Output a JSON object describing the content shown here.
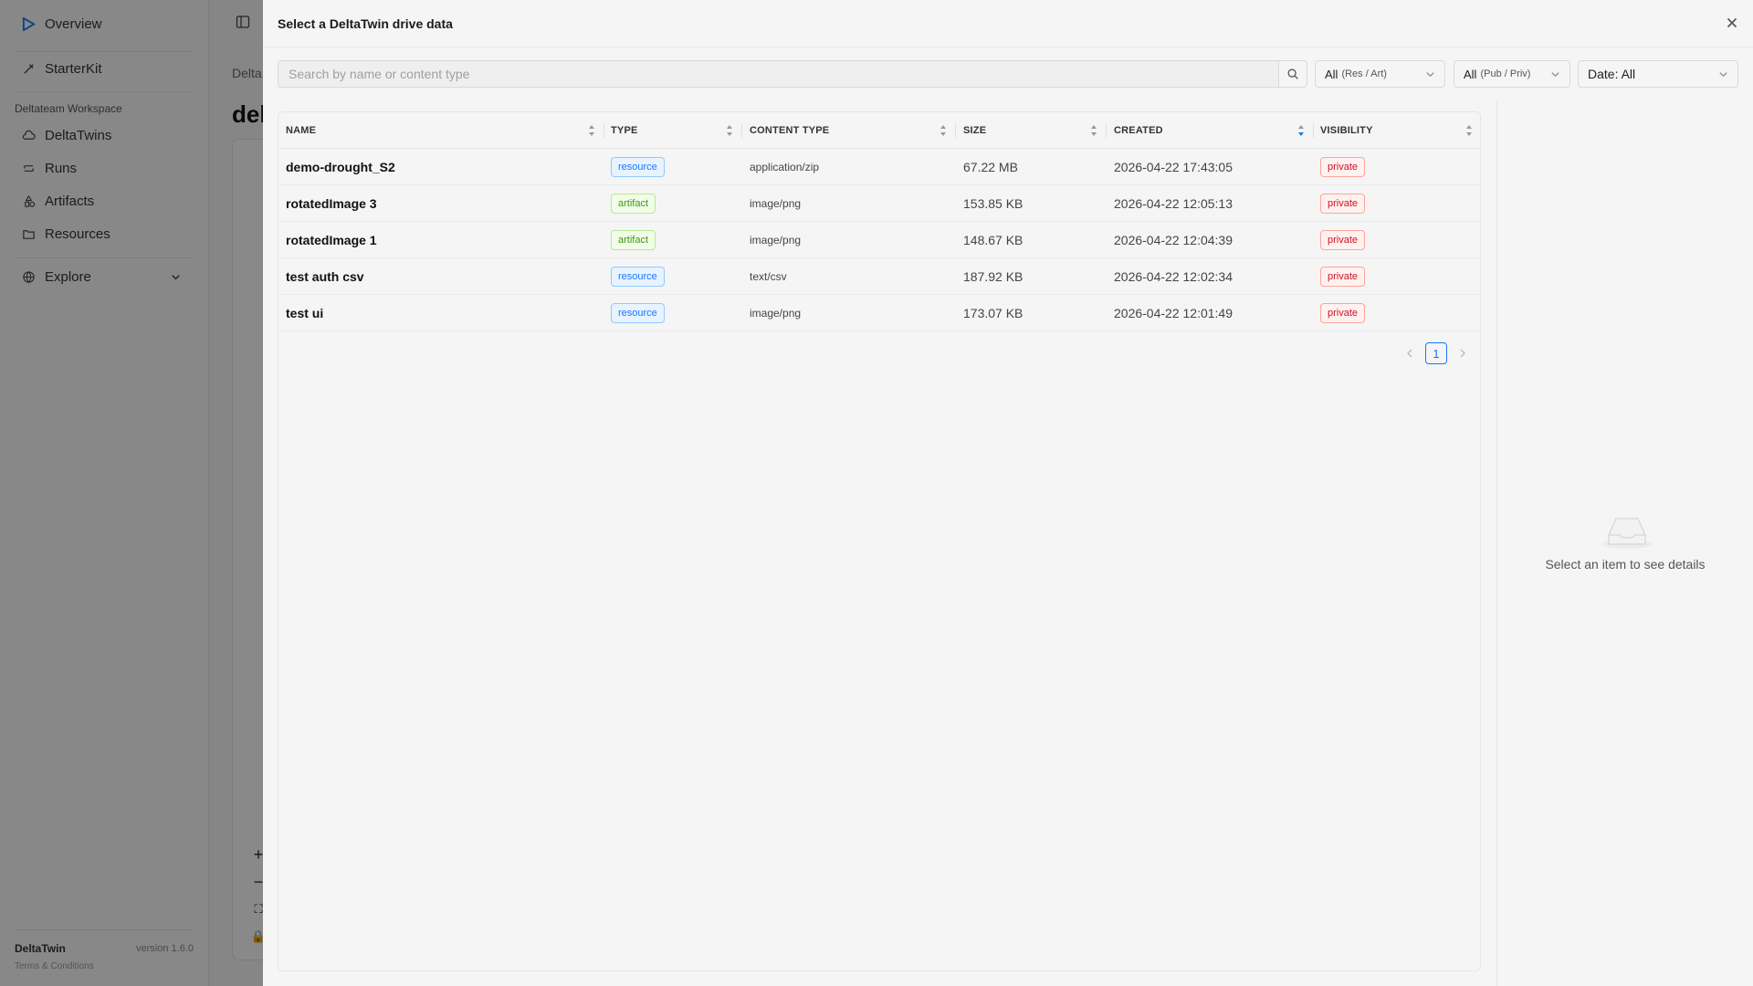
{
  "app": {
    "brand": "Overview",
    "starterkit": "StarterKit",
    "workspace_label": "Deltateam Workspace",
    "nav": [
      {
        "label": "DeltaTwins",
        "icon": "cloud-icon"
      },
      {
        "label": "Runs",
        "icon": "runs-icon"
      },
      {
        "label": "Artifacts",
        "icon": "artifacts-icon"
      },
      {
        "label": "Resources",
        "icon": "folder-icon"
      }
    ],
    "explore": "Explore",
    "footer_name": "DeltaTwin",
    "footer_version": "version 1.6.0",
    "footer_terms": "Terms & Conditions",
    "breadcrumb": "Delta",
    "page_title": "del"
  },
  "modal": {
    "title": "Select a DeltaTwin drive data",
    "search_placeholder": "Search by name or content type",
    "filters": {
      "kind": {
        "value": "All",
        "sub": "(Res / Art)"
      },
      "access": {
        "value": "All",
        "sub": "(Pub / Priv)"
      },
      "date": {
        "value": "Date: All"
      }
    },
    "columns": [
      "NAME",
      "TYPE",
      "CONTENT TYPE",
      "SIZE",
      "CREATED",
      "VISIBILITY"
    ],
    "rows": [
      {
        "name": "demo-drought_S2",
        "type": "resource",
        "content_type": "application/zip",
        "size": "67.22 MB",
        "created": "2026-04-22 17:43:05",
        "visibility": "private"
      },
      {
        "name": "rotatedImage 3",
        "type": "artifact",
        "content_type": "image/png",
        "size": "153.85 KB",
        "created": "2026-04-22 12:05:13",
        "visibility": "private"
      },
      {
        "name": "rotatedImage 1",
        "type": "artifact",
        "content_type": "image/png",
        "size": "148.67 KB",
        "created": "2026-04-22 12:04:39",
        "visibility": "private"
      },
      {
        "name": "test auth csv",
        "type": "resource",
        "content_type": "text/csv",
        "size": "187.92 KB",
        "created": "2026-04-22 12:02:34",
        "visibility": "private"
      },
      {
        "name": "test ui",
        "type": "resource",
        "content_type": "image/png",
        "size": "173.07 KB",
        "created": "2026-04-22 12:01:49",
        "visibility": "private"
      }
    ],
    "pagination": {
      "current_page": "1"
    },
    "details_empty": "Select an item to see details"
  }
}
